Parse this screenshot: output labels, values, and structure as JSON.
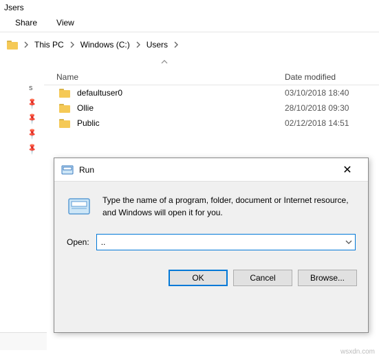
{
  "window": {
    "title": "Jsers"
  },
  "tabs": {
    "share": "Share",
    "view": "View"
  },
  "breadcrumb": {
    "item1": "This PC",
    "item2": "Windows (C:)",
    "item3": "Users"
  },
  "columns": {
    "name": "Name",
    "date": "Date modified"
  },
  "quick": {
    "item0": "s"
  },
  "files": {
    "item0": {
      "name": "defaultuser0",
      "date": "03/10/2018 18:40"
    },
    "item1": {
      "name": "Ollie",
      "date": "28/10/2018 09:30"
    },
    "item2": {
      "name": "Public",
      "date": "02/12/2018 14:51"
    }
  },
  "run": {
    "title": "Run",
    "desc": "Type the name of a program, folder, document or Internet resource, and Windows will open it for you.",
    "open_label": "Open:",
    "value": "..",
    "ok": "OK",
    "cancel": "Cancel",
    "browse": "Browse..."
  }
}
